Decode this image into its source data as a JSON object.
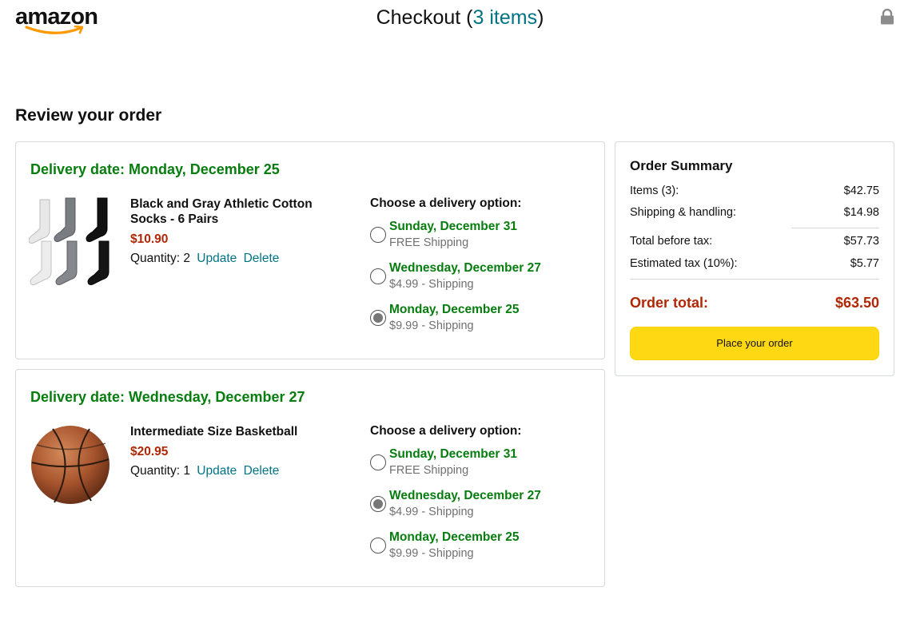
{
  "header": {
    "logo_text": "amazon",
    "title_prefix": "Checkout (",
    "items_link": "3 items",
    "title_suffix": ")",
    "lock_icon": "lock-icon"
  },
  "page_heading": "Review your order",
  "orders": [
    {
      "delivery_date": "Delivery date: Monday, December 25",
      "product_name": "Black and Gray Athletic Cotton Socks - 6 Pairs",
      "price": "$10.90",
      "quantity_label": "Quantity: 2",
      "update_label": "Update",
      "delete_label": "Delete",
      "options_title": "Choose a delivery option:",
      "options": [
        {
          "date": "Sunday, December 31",
          "cost": "FREE Shipping",
          "selected": false
        },
        {
          "date": "Wednesday, December 27",
          "cost": "$4.99 - Shipping",
          "selected": false
        },
        {
          "date": "Monday, December 25",
          "cost": "$9.99 - Shipping",
          "selected": true
        }
      ]
    },
    {
      "delivery_date": "Delivery date: Wednesday, December 27",
      "product_name": "Intermediate Size Basketball",
      "price": "$20.95",
      "quantity_label": "Quantity: 1",
      "update_label": "Update",
      "delete_label": "Delete",
      "options_title": "Choose a delivery option:",
      "options": [
        {
          "date": "Sunday, December 31",
          "cost": "FREE Shipping",
          "selected": false
        },
        {
          "date": "Wednesday, December 27",
          "cost": "$4.99 - Shipping",
          "selected": true
        },
        {
          "date": "Monday, December 25",
          "cost": "$9.99 - Shipping",
          "selected": false
        }
      ]
    }
  ],
  "summary": {
    "title": "Order Summary",
    "items_label": "Items (3):",
    "items_value": "$42.75",
    "shipping_label": "Shipping & handling:",
    "shipping_value": "$14.98",
    "before_tax_label": "Total before tax:",
    "before_tax_value": "$57.73",
    "tax_label": "Estimated tax (10%):",
    "tax_value": "$5.77",
    "total_label": "Order total:",
    "total_value": "$63.50",
    "place_order_label": "Place your order"
  },
  "colors": {
    "delivery_green": "#067d0e",
    "price_red": "#b12704",
    "link_teal": "#017384",
    "button_yellow": "#ffd814"
  }
}
